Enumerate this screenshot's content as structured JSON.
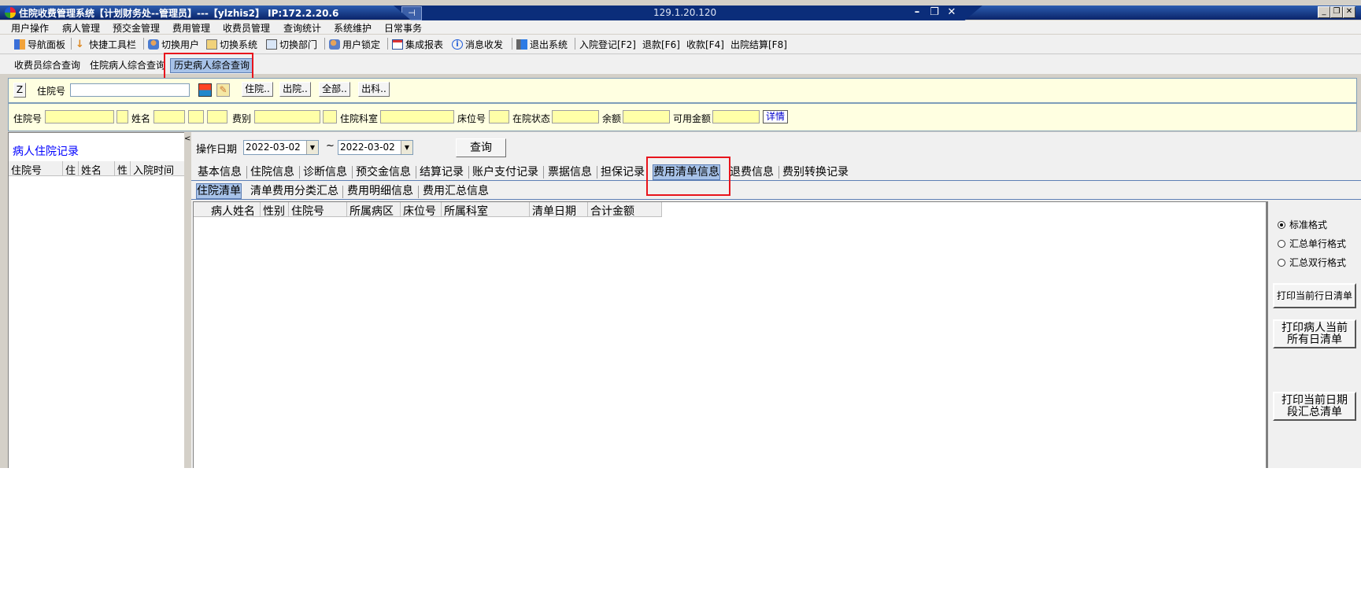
{
  "window": {
    "title": "住院收费管理系统【计划财务处--管理员】---【ylzhis2】 IP:172.2.20.6",
    "remote_ip": "129.1.20.120"
  },
  "menu": [
    "用户操作",
    "病人管理",
    "预交金管理",
    "费用管理",
    "收费员管理",
    "查询统计",
    "系统维护",
    "日常事务"
  ],
  "toolbar": {
    "items": [
      {
        "label": "导航面板",
        "icon": "navigation-panel-icon"
      },
      {
        "label": "快捷工具栏",
        "icon": "quick-toolbar-icon"
      },
      {
        "label": "切换用户",
        "icon": "switch-user-icon"
      },
      {
        "label": "切换系统",
        "icon": "switch-system-icon"
      },
      {
        "label": "切换部门",
        "icon": "switch-department-icon"
      },
      {
        "label": "用户锁定",
        "icon": "user-lock-icon"
      },
      {
        "label": "集成报表",
        "icon": "integrated-report-icon"
      },
      {
        "label": "消息收发",
        "icon": "message-icon"
      },
      {
        "label": "退出系统",
        "icon": "exit-icon"
      }
    ],
    "shortcuts": [
      "入院登记[F2]",
      "退款[F6]",
      "收款[F4]",
      "出院结算[F8]"
    ]
  },
  "top_tabs": [
    "收费员综合查询",
    "住院病人综合查询",
    "历史病人综合查询"
  ],
  "search": {
    "z_button": "Z",
    "inpatient_no_label": "住院号",
    "buttons": [
      "住院..",
      "出院..",
      "全部..",
      "出科.."
    ]
  },
  "patient_info": {
    "labels": {
      "inpatient_no": "住院号",
      "name": "姓名",
      "fee_type": "费别",
      "department": "住院科室",
      "bed_no": "床位号",
      "status": "在院状态",
      "balance": "余额",
      "available": "可用金额"
    },
    "detail_link": "详情"
  },
  "left_panel": {
    "title": "病人住院记录",
    "columns": [
      "住院号",
      "住",
      "姓名",
      "性",
      "入院时间"
    ]
  },
  "query": {
    "op_date_label": "操作日期",
    "date_from": "2022-03-02",
    "date_sep": "~",
    "date_to": "2022-03-02",
    "query_button": "查询"
  },
  "info_tabs": [
    "基本信息",
    "住院信息",
    "诊断信息",
    "预交金信息",
    "结算记录",
    "账户支付记录",
    "票据信息",
    "担保记录",
    "费用清单信息",
    "退费信息",
    "费别转换记录"
  ],
  "sub_tabs": [
    "住院清单",
    "清单费用分类汇总",
    "费用明细信息",
    "费用汇总信息"
  ],
  "grid": {
    "columns": [
      "病人姓名",
      "性别",
      "住院号",
      "所属病区",
      "床位号",
      "所属科室",
      "清单日期",
      "合计金额"
    ]
  },
  "side": {
    "radios": [
      "标准格式",
      "汇总单行格式",
      "汇总双行格式"
    ],
    "selected_radio": "标准格式",
    "btn_print_day": "打印当前行日清单",
    "btn_print_all_line1": "打印病人当前",
    "btn_print_all_line2": "所有日清单",
    "btn_print_range_line1": "打印当前日期",
    "btn_print_range_line2": "段汇总清单"
  },
  "colors": {
    "highlight_box": "#e8141c",
    "active_tab": "#a7c2e8",
    "panel_bg": "#ffffe1"
  }
}
